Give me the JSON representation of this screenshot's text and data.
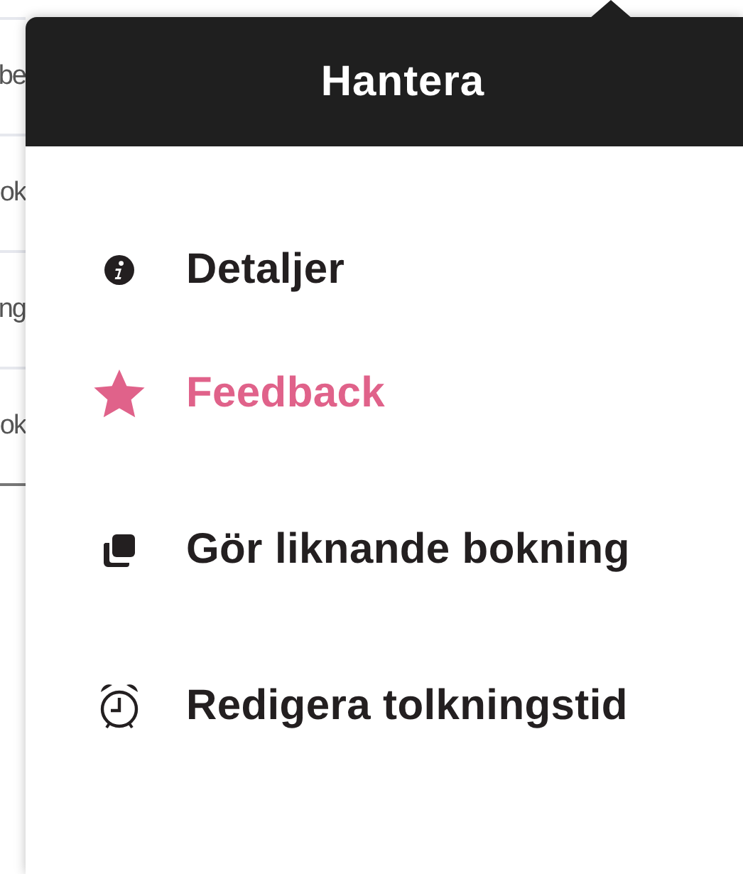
{
  "background_rows": [
    {
      "text": "be"
    },
    {
      "text": "ok"
    },
    {
      "text": "ng"
    },
    {
      "text": "ok"
    }
  ],
  "popover": {
    "title": "Hantera",
    "items": [
      {
        "kind": "info",
        "label": "Detaljer",
        "selected": false
      },
      {
        "kind": "star",
        "label": "Feedback",
        "selected": true
      },
      {
        "kind": "copy",
        "label": "Gör liknande bokning",
        "selected": false
      },
      {
        "kind": "alarm",
        "label": "Redigera tolkningstid",
        "selected": false
      }
    ]
  }
}
